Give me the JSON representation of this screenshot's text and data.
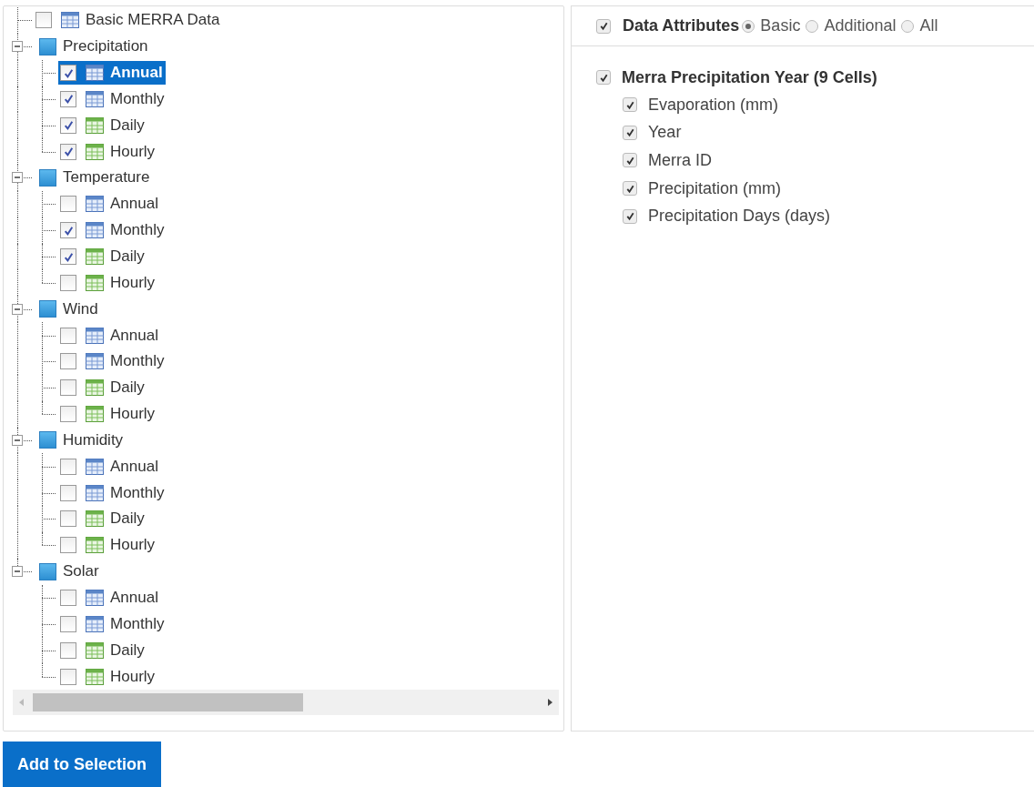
{
  "tree": [
    {
      "kind": "table",
      "label": "Basic MERRA Data",
      "checked": false,
      "selected": false
    },
    {
      "kind": "folder",
      "label": "Precipitation",
      "expanded": true,
      "children": [
        {
          "kind": "summary",
          "label": "Annual",
          "checked": true,
          "selected": true
        },
        {
          "kind": "summary",
          "label": "Monthly",
          "checked": true,
          "selected": false
        },
        {
          "kind": "series",
          "label": "Daily",
          "checked": true,
          "selected": false
        },
        {
          "kind": "series",
          "label": "Hourly",
          "checked": true,
          "selected": false
        }
      ]
    },
    {
      "kind": "folder",
      "label": "Temperature",
      "expanded": true,
      "children": [
        {
          "kind": "summary",
          "label": "Annual",
          "checked": false,
          "selected": false
        },
        {
          "kind": "summary",
          "label": "Monthly",
          "checked": true,
          "selected": false
        },
        {
          "kind": "series",
          "label": "Daily",
          "checked": true,
          "selected": false
        },
        {
          "kind": "series",
          "label": "Hourly",
          "checked": false,
          "selected": false
        }
      ]
    },
    {
      "kind": "folder",
      "label": "Wind",
      "expanded": true,
      "children": [
        {
          "kind": "summary",
          "label": "Annual",
          "checked": false,
          "selected": false
        },
        {
          "kind": "summary",
          "label": "Monthly",
          "checked": false,
          "selected": false
        },
        {
          "kind": "series",
          "label": "Daily",
          "checked": false,
          "selected": false
        },
        {
          "kind": "series",
          "label": "Hourly",
          "checked": false,
          "selected": false
        }
      ]
    },
    {
      "kind": "folder",
      "label": "Humidity",
      "expanded": true,
      "children": [
        {
          "kind": "summary",
          "label": "Annual",
          "checked": false,
          "selected": false
        },
        {
          "kind": "summary",
          "label": "Monthly",
          "checked": false,
          "selected": false
        },
        {
          "kind": "series",
          "label": "Daily",
          "checked": false,
          "selected": false
        },
        {
          "kind": "series",
          "label": "Hourly",
          "checked": false,
          "selected": false
        }
      ]
    },
    {
      "kind": "folder",
      "label": "Solar",
      "expanded": true,
      "children": [
        {
          "kind": "summary",
          "label": "Annual",
          "checked": false,
          "selected": false
        },
        {
          "kind": "summary",
          "label": "Monthly",
          "checked": false,
          "selected": false
        },
        {
          "kind": "series",
          "label": "Daily",
          "checked": false,
          "selected": false
        },
        {
          "kind": "series",
          "label": "Hourly",
          "checked": false,
          "selected": false
        }
      ]
    }
  ],
  "attributes_header": {
    "label": "Data Attributes",
    "checked": true,
    "options": [
      {
        "label": "Basic",
        "selected": true
      },
      {
        "label": "Additional",
        "selected": false
      },
      {
        "label": "All",
        "selected": false
      }
    ]
  },
  "attribute_group": {
    "title": "Merra Precipitation Year (9 Cells)",
    "checked": true,
    "items": [
      {
        "label": "Evaporation (mm)",
        "checked": true
      },
      {
        "label": "Year",
        "checked": true
      },
      {
        "label": "Merra ID",
        "checked": true
      },
      {
        "label": "Precipitation (mm)",
        "checked": true
      },
      {
        "label": "Precipitation Days (days)",
        "checked": true
      }
    ]
  },
  "button": "Add to Selection"
}
